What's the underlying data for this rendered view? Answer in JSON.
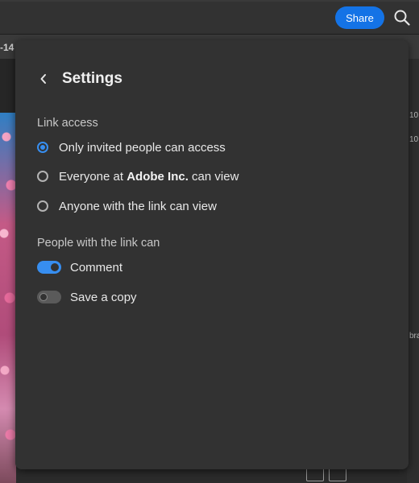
{
  "header": {
    "share_label": "Share",
    "icons": {
      "search": "search-icon"
    },
    "colors": {
      "accent": "#1473e6"
    }
  },
  "background": {
    "left_tab_stub": "-14",
    "right_stubs": [
      "10",
      "10",
      "bra"
    ]
  },
  "settings": {
    "title": "Settings",
    "back_icon": "chevron-left-icon",
    "link_access": {
      "label": "Link access",
      "options": [
        {
          "text": "Only invited people can access",
          "selected": true
        },
        {
          "text_before": "Everyone at ",
          "text_bold": "Adobe Inc.",
          "text_after": " can view",
          "selected": false
        },
        {
          "text": "Anyone with the link can view",
          "selected": false
        }
      ]
    },
    "permissions": {
      "label": "People with the link can",
      "toggles": [
        {
          "label": "Comment",
          "on": true
        },
        {
          "label": "Save a copy",
          "on": false
        }
      ]
    },
    "colors": {
      "accent": "#378ef0"
    }
  }
}
